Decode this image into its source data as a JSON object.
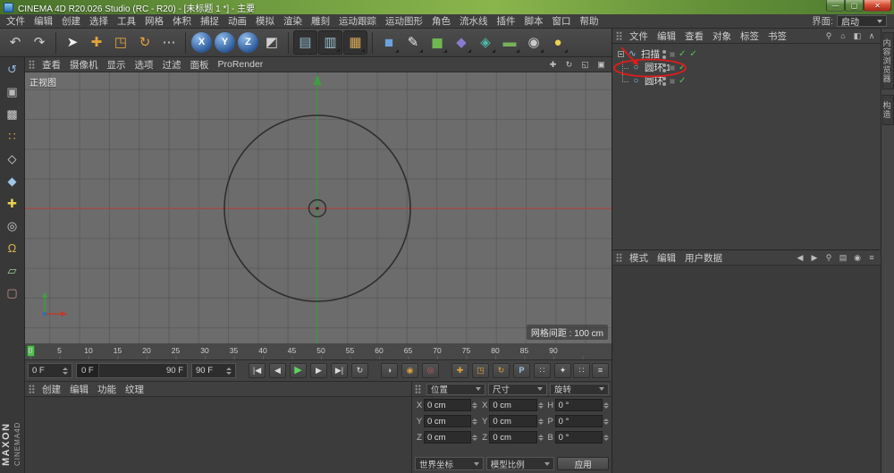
{
  "window": {
    "title": "CINEMA 4D R20.026 Studio (RC - R20) - [未标题 1 *] - 主要",
    "minimize": "—",
    "maximize": "▢",
    "close": "✕"
  },
  "menubar": {
    "items": [
      "文件",
      "编辑",
      "创建",
      "选择",
      "工具",
      "网格",
      "体积",
      "捕捉",
      "动画",
      "模拟",
      "渲染",
      "雕刻",
      "运动跟踪",
      "运动图形",
      "角色",
      "流水线",
      "插件",
      "脚本",
      "窗口",
      "帮助"
    ],
    "interface_label": "界面:",
    "interface_value": "启动"
  },
  "toolbar": {
    "icons": [
      {
        "name": "undo",
        "glyph": "↶"
      },
      {
        "name": "redo",
        "glyph": "↷"
      },
      {
        "name": "live-selection",
        "glyph": "➤"
      },
      {
        "name": "move",
        "glyph": "✚"
      },
      {
        "name": "scale",
        "glyph": "◳"
      },
      {
        "name": "rotate",
        "glyph": "↻"
      },
      {
        "name": "recent-tools",
        "glyph": "⋯"
      },
      {
        "name": "lock-x",
        "glyph": "X"
      },
      {
        "name": "lock-y",
        "glyph": "Y"
      },
      {
        "name": "lock-z",
        "glyph": "Z"
      },
      {
        "name": "coordinate-system",
        "glyph": "◩"
      },
      {
        "name": "render-view",
        "glyph": "▤"
      },
      {
        "name": "render-picture-viewer",
        "glyph": "▥"
      },
      {
        "name": "render-settings",
        "glyph": "▦"
      },
      {
        "name": "primitive-cube",
        "glyph": "■"
      },
      {
        "name": "spline-pen",
        "glyph": "✎"
      },
      {
        "name": "subdivision-surface",
        "glyph": "◼"
      },
      {
        "name": "volume-builder",
        "glyph": "◆"
      },
      {
        "name": "deformer",
        "glyph": "◈"
      },
      {
        "name": "floor",
        "glyph": "▬"
      },
      {
        "name": "camera",
        "glyph": "◉"
      },
      {
        "name": "light",
        "glyph": "●"
      }
    ]
  },
  "leftbar": {
    "icons": [
      {
        "name": "make-editable",
        "glyph": "↺"
      },
      {
        "name": "model-mode",
        "glyph": "▣"
      },
      {
        "name": "texture-mode",
        "glyph": "▩"
      },
      {
        "name": "point-mode",
        "glyph": "∷"
      },
      {
        "name": "edge-mode",
        "glyph": "◇"
      },
      {
        "name": "polygon-mode",
        "glyph": "◆"
      },
      {
        "name": "axis-mode",
        "glyph": "✚"
      },
      {
        "name": "solo-mode",
        "glyph": "◎"
      },
      {
        "name": "snap-mode",
        "glyph": "Ω"
      },
      {
        "name": "workplane-mode",
        "glyph": "▱"
      },
      {
        "name": "lock-workplane",
        "glyph": "▢"
      }
    ],
    "brand_maxon": "MAXON",
    "brand_cinema": "CINEMA4D"
  },
  "viewport": {
    "menu": [
      "查看",
      "摄像机",
      "显示",
      "选项",
      "过滤",
      "面板",
      "ProRender"
    ],
    "controls": [
      {
        "name": "pan-view",
        "glyph": "✚"
      },
      {
        "name": "orbit-view",
        "glyph": "↻"
      },
      {
        "name": "zoom-view",
        "glyph": "◱"
      },
      {
        "name": "toggle-view",
        "glyph": "▣"
      }
    ],
    "view_label": "正视图",
    "grid_spacing_label": "网格间距 : 100 cm"
  },
  "timeline": {
    "ticks": [
      "0",
      "5",
      "10",
      "15",
      "20",
      "25",
      "30",
      "35",
      "40",
      "45",
      "50",
      "55",
      "60",
      "65",
      "70",
      "75",
      "80",
      "85",
      "90"
    ]
  },
  "transport": {
    "current_frame": "0 F",
    "slider_start": "0 F",
    "slider_end": "90 F",
    "range_end": "90 F",
    "play_buttons": [
      {
        "name": "goto-start",
        "glyph": "|◀"
      },
      {
        "name": "prev-frame",
        "glyph": "◀"
      },
      {
        "name": "play",
        "glyph": "▶"
      },
      {
        "name": "next-frame",
        "glyph": "▶"
      },
      {
        "name": "goto-end",
        "glyph": "▶|"
      },
      {
        "name": "loop",
        "glyph": "↻"
      }
    ],
    "record_buttons": [
      {
        "name": "record-keyframe",
        "glyph": "◑"
      },
      {
        "name": "autokey",
        "glyph": "◉"
      },
      {
        "name": "keyframe-selection",
        "glyph": "◎"
      }
    ],
    "key_toggles": [
      {
        "name": "key-position",
        "glyph": "✚"
      },
      {
        "name": "key-scale",
        "glyph": "◳"
      },
      {
        "name": "key-rotation",
        "glyph": "↻"
      },
      {
        "name": "key-parameter",
        "glyph": "P"
      },
      {
        "name": "key-pla",
        "glyph": "∷"
      }
    ],
    "extra_buttons": [
      {
        "name": "timeline-key",
        "glyph": "✦"
      },
      {
        "name": "timeline-grid",
        "glyph": "∷"
      },
      {
        "name": "timeline-menu",
        "glyph": "≡"
      }
    ]
  },
  "object_manager": {
    "menu": [
      "文件",
      "编辑",
      "查看",
      "对象",
      "标签",
      "书签"
    ],
    "header_icons": [
      {
        "name": "search",
        "glyph": "⚲"
      },
      {
        "name": "home",
        "glyph": "⌂"
      },
      {
        "name": "dock",
        "glyph": "◧"
      },
      {
        "name": "scroll-up",
        "glyph": "∧"
      }
    ],
    "objects": [
      {
        "label": "扫描",
        "icon_glyph": "∿"
      },
      {
        "label": "圆环.1",
        "icon_glyph": "○"
      },
      {
        "label": "圆环",
        "icon_glyph": "○"
      }
    ],
    "check_glyph": "✓"
  },
  "attribute_manager": {
    "menu": [
      "模式",
      "编辑",
      "用户数据"
    ],
    "header_icons": [
      {
        "name": "back",
        "glyph": "◀"
      },
      {
        "name": "forward",
        "glyph": "▶"
      },
      {
        "name": "search",
        "glyph": "⚲"
      },
      {
        "name": "grid",
        "glyph": "▤"
      },
      {
        "name": "lock",
        "glyph": "◉"
      },
      {
        "name": "panel-menu",
        "glyph": "≡"
      }
    ]
  },
  "material_manager": {
    "menu": [
      "创建",
      "编辑",
      "功能",
      "纹理"
    ]
  },
  "coordinates": {
    "headers": [
      "位置",
      "尺寸",
      "旋转"
    ],
    "axis_labels": {
      "x": "X",
      "y": "Y",
      "z": "Z",
      "h": "H",
      "p": "P",
      "b": "B"
    },
    "position": {
      "x": "0 cm",
      "y": "0 cm",
      "z": "0 cm"
    },
    "size": {
      "x": "0 cm",
      "y": "0 cm",
      "z": "0 cm"
    },
    "rotation": {
      "h": "0 °",
      "p": "0 °",
      "b": "0 °"
    },
    "coord_system": "世界坐标",
    "size_mode": "模型比例",
    "apply": "应用"
  },
  "side_tabs": {
    "tabs": [
      "内容浏览器",
      "构造"
    ]
  }
}
